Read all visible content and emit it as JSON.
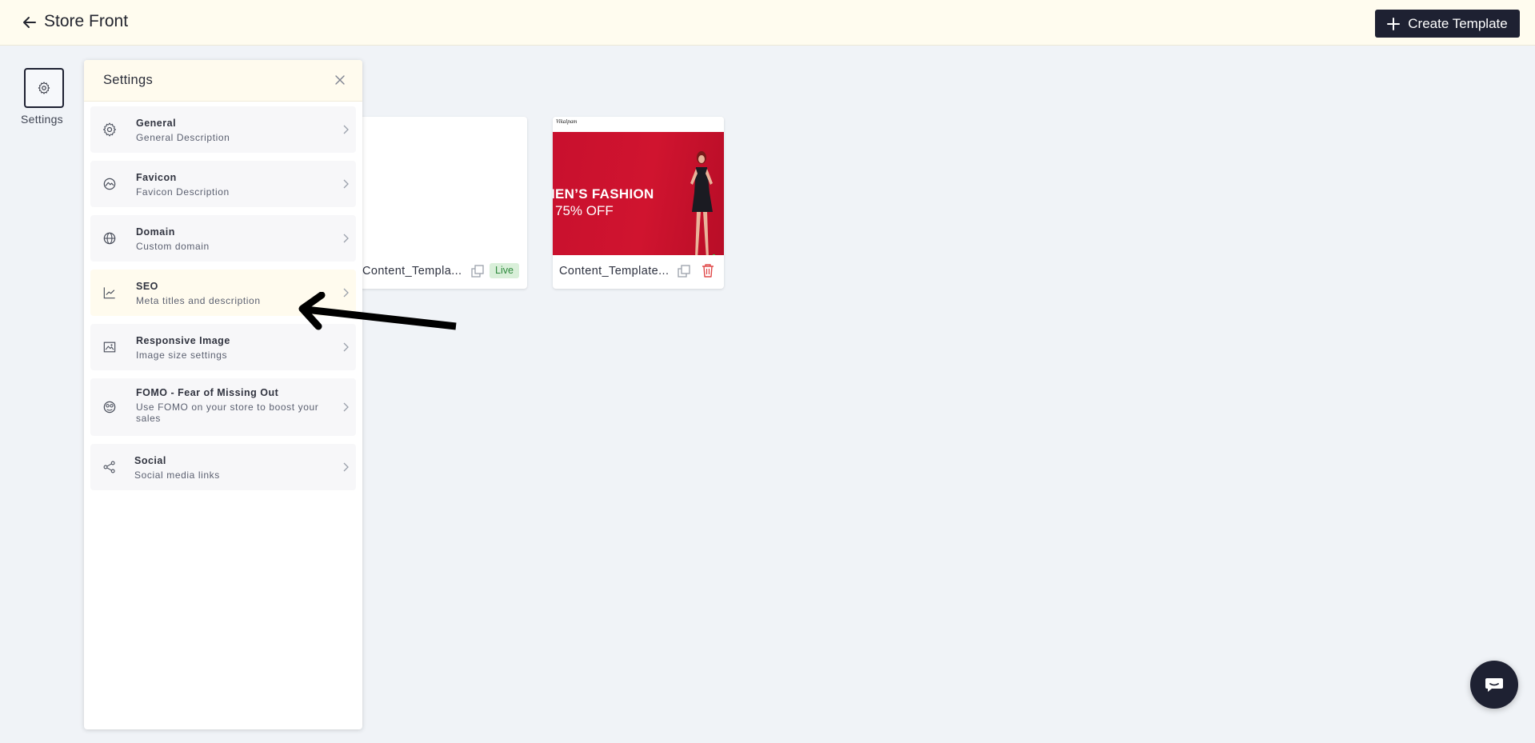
{
  "header": {
    "title": "Store Front",
    "create_button_label": "Create Template"
  },
  "rail": {
    "settings_label": "Settings"
  },
  "templates": [
    {
      "name": "Content_Templa...",
      "status": "Live"
    },
    {
      "name": "Content_Template...",
      "preview": {
        "logo": "Vikalpam",
        "headline": "IEN’S FASHION",
        "offer": "75% OFF",
        "banner_color": "#c8102e"
      }
    }
  ],
  "settings_panel": {
    "title": "Settings",
    "items": [
      {
        "title": "General",
        "description": "General Description",
        "icon": "gear-icon"
      },
      {
        "title": "Favicon",
        "description": "Favicon Description",
        "icon": "favicon-icon"
      },
      {
        "title": "Domain",
        "description": "Custom domain",
        "icon": "globe-icon"
      },
      {
        "title": "SEO",
        "description": "Meta titles and description",
        "icon": "chart-line-icon"
      },
      {
        "title": "Responsive Image",
        "description": "Image size settings",
        "icon": "image-icon"
      },
      {
        "title": "FOMO - Fear of Missing Out",
        "description": "Use FOMO on your store to boost your sales",
        "icon": "fomo-icon"
      },
      {
        "title": "Social",
        "description": "Social media links",
        "icon": "share-icon"
      }
    ]
  },
  "colors": {
    "header_bg": "#fffcef",
    "dark": "#1e2132",
    "page_bg": "#f0f3f7",
    "live_badge": "#d9efd9"
  }
}
